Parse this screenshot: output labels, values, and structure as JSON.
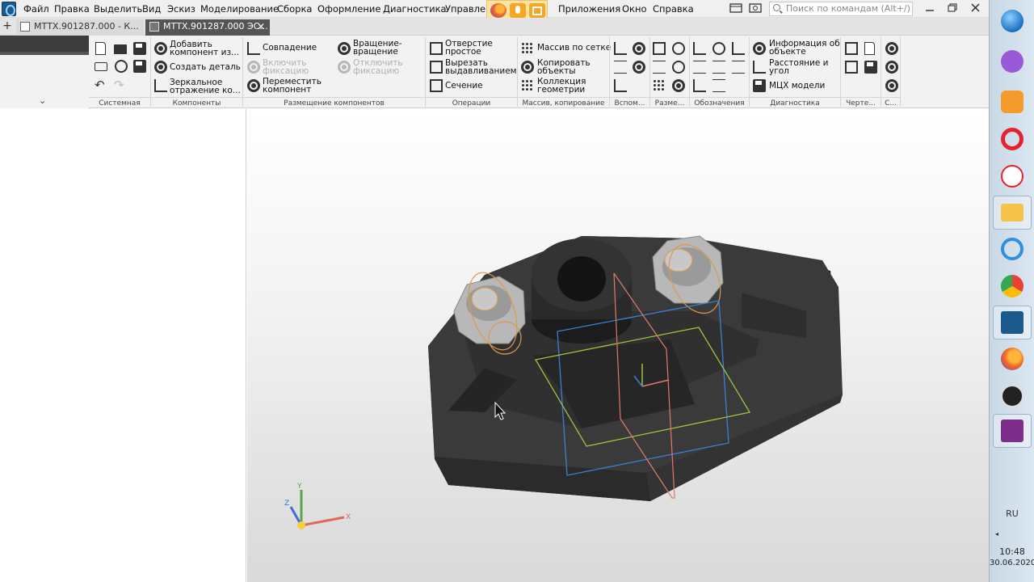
{
  "menu": {
    "items": [
      "Файл",
      "Правка",
      "Выделить",
      "Вид",
      "Эскиз",
      "Моделирование",
      "Сборка",
      "Оформление",
      "Диагностика",
      "Управлен"
    ],
    "items_right": [
      "Приложения",
      "Окно",
      "Справка"
    ],
    "search_placeholder": "Поиск по командам (Alt+/)"
  },
  "tabs": [
    {
      "label": "МТТХ.901287.000 - К..."
    },
    {
      "label": "МТТХ.901287.000 ЭС...",
      "close": "✕"
    }
  ],
  "tab_add": "+",
  "ribbon": {
    "collapse_glyph": "⌄",
    "groups": [
      {
        "label": "Системная"
      },
      {
        "label": "Компоненты"
      },
      {
        "label": "Размещение компонентов"
      },
      {
        "label": "Операции"
      },
      {
        "label": "Массив, копирование"
      },
      {
        "label": "Вспом..."
      },
      {
        "label": "Разме..."
      },
      {
        "label": "Обозначения"
      },
      {
        "label": "Диагностика"
      },
      {
        "label": "Черте..."
      },
      {
        "label": "С..."
      }
    ],
    "components": {
      "add_from": "Добавить\nкомпонент из...",
      "create_part": "Создать деталь",
      "mirror": "Зеркальное\nотражение ко..."
    },
    "placement": {
      "coincidence": "Совпадение",
      "rotation": "Вращение-\nвращение",
      "fix_on": "Включить\nфиксацию",
      "fix_off": "Отключить\nфиксацию",
      "move": "Переместить\nкомпонент"
    },
    "operations": {
      "hole": "Отверстие\nпростое",
      "extrude_cut": "Вырезать\nвыдавливанием",
      "section": "Сечение"
    },
    "array": {
      "grid_array": "Массив по сетке",
      "copy_objects": "Копировать\nобъекты",
      "geometry_collection": "Коллекция\nгеометрии"
    },
    "diagnostics": {
      "object_info": "Информация об\nобъекте",
      "distance_angle": "Расстояние и\nугол",
      "mcx": "МЦХ модели"
    }
  },
  "viewport": {
    "axes": {
      "x": "X",
      "y": "Y",
      "z": "Z"
    }
  },
  "taskbar": {
    "icons": [
      "windows-start",
      "purple-app",
      "player",
      "opera",
      "yandex",
      "file-explorer",
      "internet-explorer",
      "chrome",
      "kompas",
      "firefox",
      "obs",
      "pdf-app"
    ],
    "lang": "RU",
    "time": "10:48",
    "date": "30.06.2020"
  },
  "colors": {
    "accent_tab": "#555555",
    "model_dark": "#2b2b2b",
    "plane_blue": "#3d7fd6",
    "plane_green": "#9bc53d",
    "plane_red": "#e07a6a",
    "nut_outline": "#d99a4e"
  }
}
